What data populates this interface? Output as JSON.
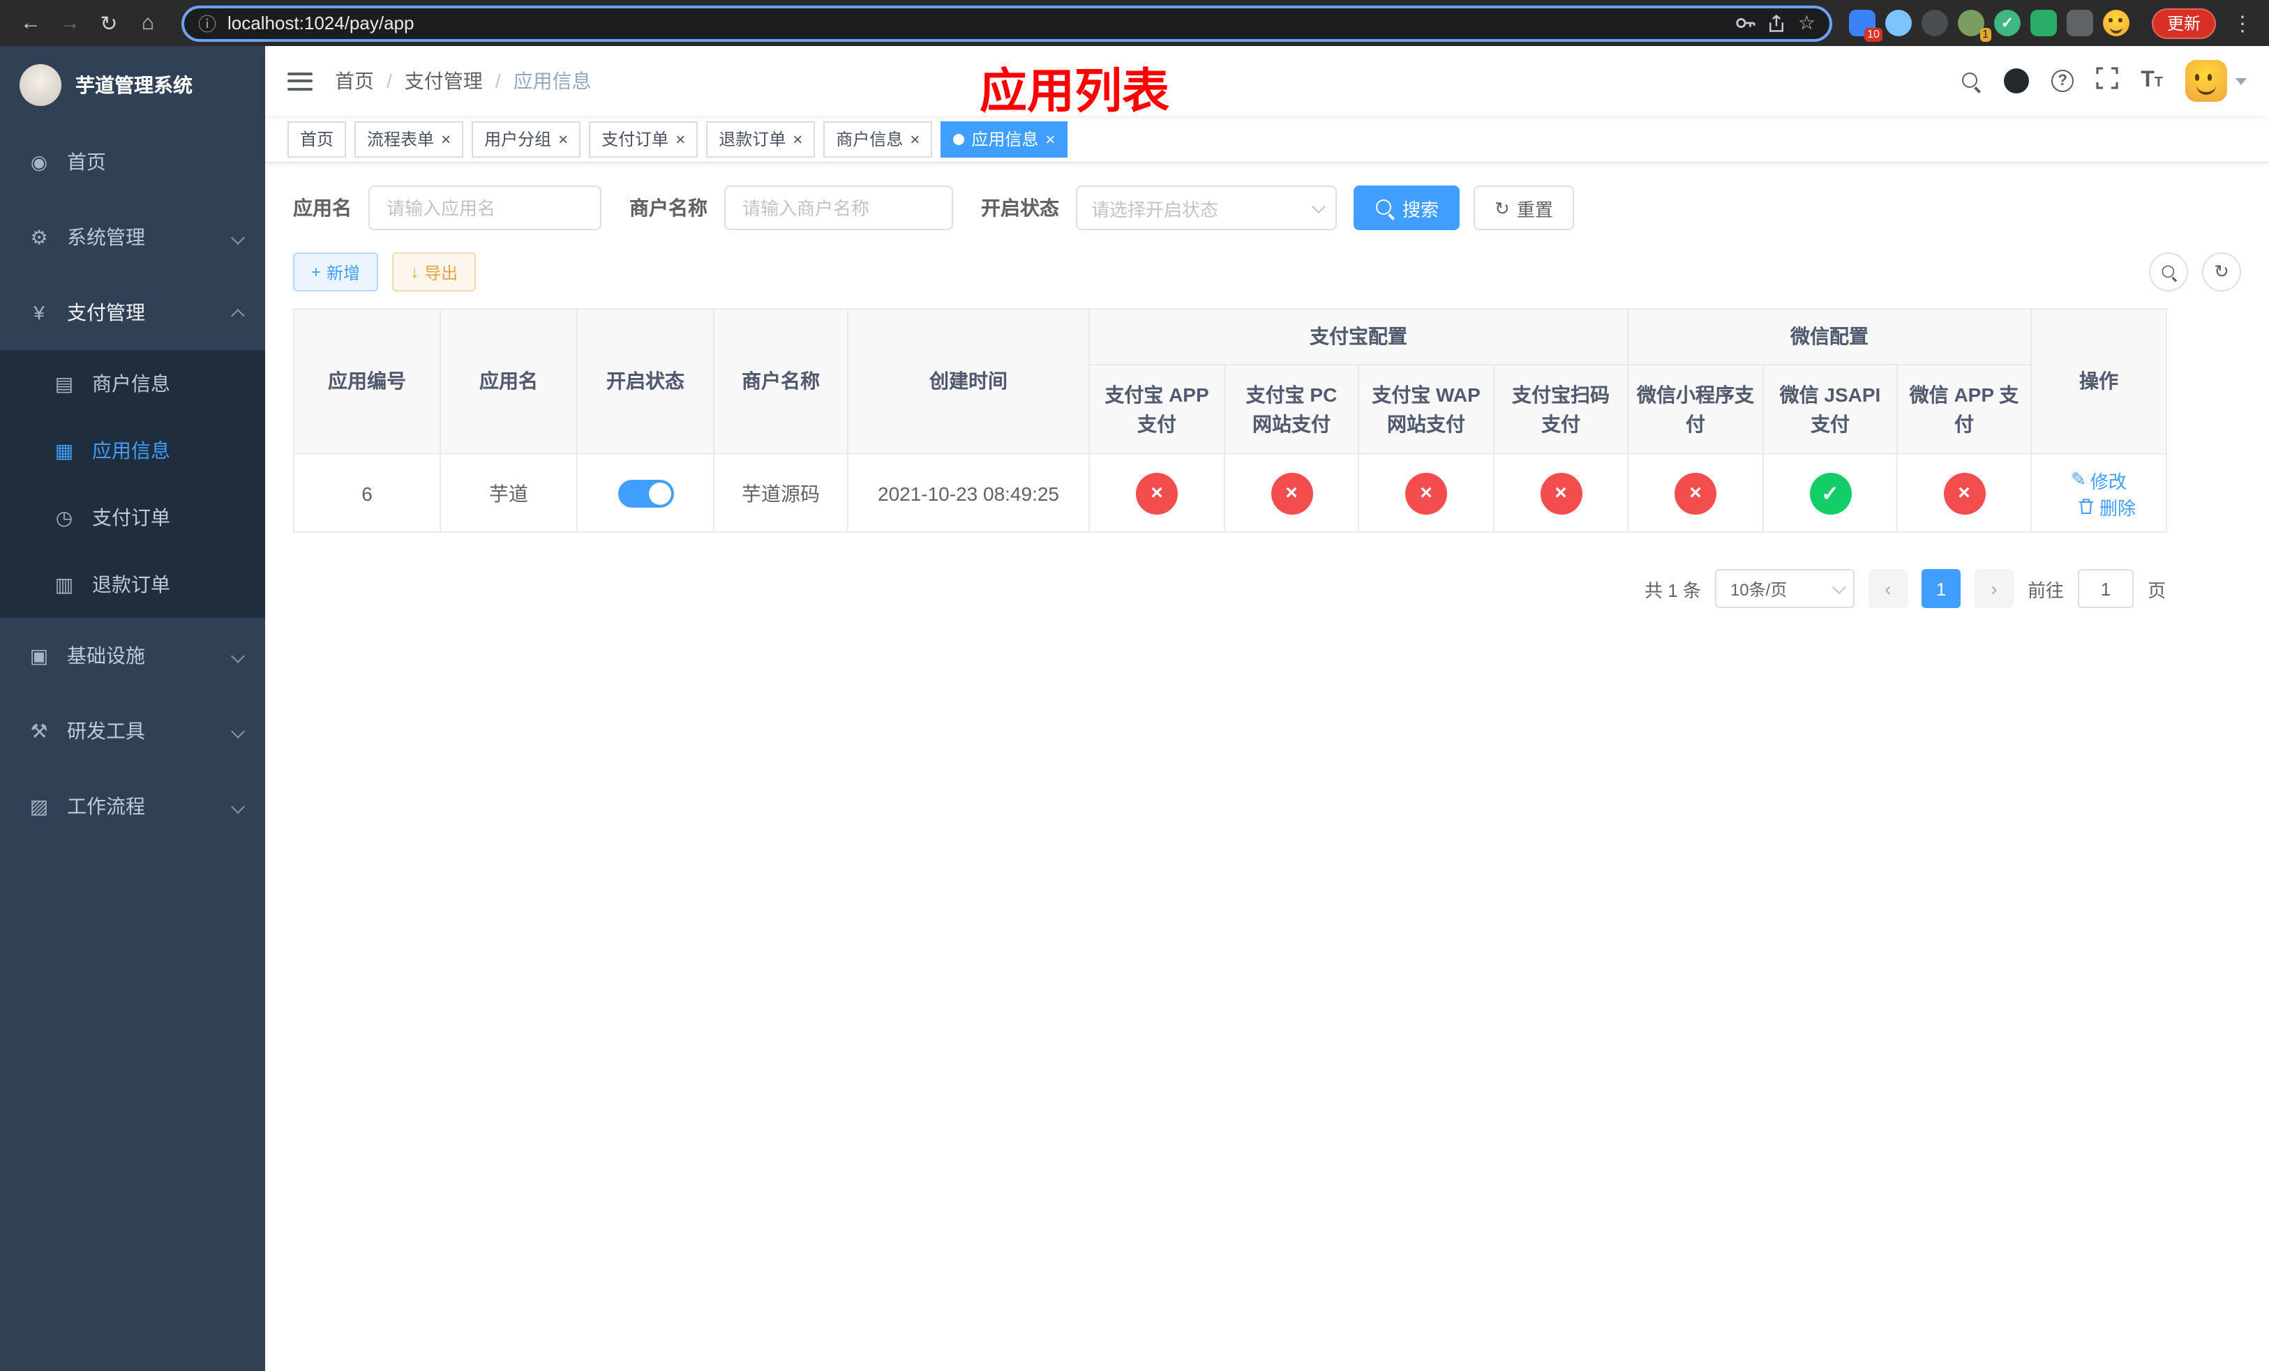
{
  "browser": {
    "url": "localhost:1024/pay/app",
    "update_label": "更新",
    "ext_badge_1": "10",
    "ext_badge_2": "1"
  },
  "icons": {
    "back": "←",
    "forward": "→",
    "reload": "↻",
    "home": "⌂",
    "info": "ⓘ",
    "star": "☆",
    "overflow": "⋮",
    "close": "×",
    "check": "✓",
    "cross": "×",
    "help": "?",
    "font_size": "T",
    "plus": "+",
    "download": "↓",
    "edit": "✎",
    "refresh": "↻",
    "chev_left": "‹",
    "chev_right": "›",
    "menu_home": "◉",
    "menu_system": "⚙",
    "menu_pay": "¥",
    "menu_merchant": "▤",
    "menu_app": "▦",
    "menu_order": "◷",
    "menu_refund": "▥",
    "menu_infra": "▣",
    "menu_tools": "⚒",
    "menu_flow": "▨"
  },
  "sidebar": {
    "logo_title": "芋道管理系统",
    "items": [
      {
        "label": "首页"
      },
      {
        "label": "系统管理"
      },
      {
        "label": "支付管理"
      },
      {
        "label": "基础设施"
      },
      {
        "label": "研发工具"
      },
      {
        "label": "工作流程"
      }
    ],
    "payment_children": [
      {
        "label": "商户信息"
      },
      {
        "label": "应用信息",
        "active": true
      },
      {
        "label": "支付订单"
      },
      {
        "label": "退款订单"
      }
    ]
  },
  "header": {
    "breadcrumb": [
      "首页",
      "支付管理",
      "应用信息"
    ],
    "separator": "/",
    "overlay_title": "应用列表"
  },
  "tabs": [
    {
      "label": "首页",
      "closable": false,
      "active": false
    },
    {
      "label": "流程表单",
      "closable": true,
      "active": false
    },
    {
      "label": "用户分组",
      "closable": true,
      "active": false
    },
    {
      "label": "支付订单",
      "closable": true,
      "active": false
    },
    {
      "label": "退款订单",
      "closable": true,
      "active": false
    },
    {
      "label": "商户信息",
      "closable": true,
      "active": false
    },
    {
      "label": "应用信息",
      "closable": true,
      "active": true
    }
  ],
  "filters": {
    "app_name_label": "应用名",
    "app_name_placeholder": "请输入应用名",
    "merchant_label": "商户名称",
    "merchant_placeholder": "请输入商户名称",
    "status_label": "开启状态",
    "status_placeholder": "请选择开启状态",
    "search_label": "搜索",
    "reset_label": "重置"
  },
  "toolbar": {
    "add_label": "新增",
    "export_label": "导出"
  },
  "table": {
    "header": {
      "app_id": "应用编号",
      "app_name": "应用名",
      "status": "开启状态",
      "merchant": "商户名称",
      "created": "创建时间",
      "alipay_group": "支付宝配置",
      "wechat_group": "微信配置",
      "alipay_app": "支付宝 APP 支付",
      "alipay_pc": "支付宝 PC 网站支付",
      "alipay_wap": "支付宝 WAP 网站支付",
      "alipay_qr": "支付宝扫码支付",
      "wx_mini": "微信小程序支付",
      "wx_jsapi": "微信 JSAPI 支付",
      "wx_app": "微信 APP 支付",
      "actions": "操作"
    },
    "row": {
      "app_id": "6",
      "app_name": "芋道",
      "enabled": true,
      "merchant": "芋道源码",
      "created": "2021-10-23 08:49:25",
      "configs": [
        false,
        false,
        false,
        false,
        false,
        true,
        false
      ],
      "edit_label": "修改",
      "delete_label": "删除"
    }
  },
  "pagination": {
    "total": "共 1 条",
    "page_size": "10条/页",
    "current": "1",
    "goto": "前往",
    "goto_value": "1",
    "unit": "页"
  },
  "colors": {
    "accent": "#409eff",
    "success": "#13ce66",
    "danger": "#f34d4d",
    "warning": "#e6a23c",
    "sidebar_bg": "#304156",
    "submenu_bg": "#1f2d3d",
    "overlay_title": "#ff0000"
  }
}
